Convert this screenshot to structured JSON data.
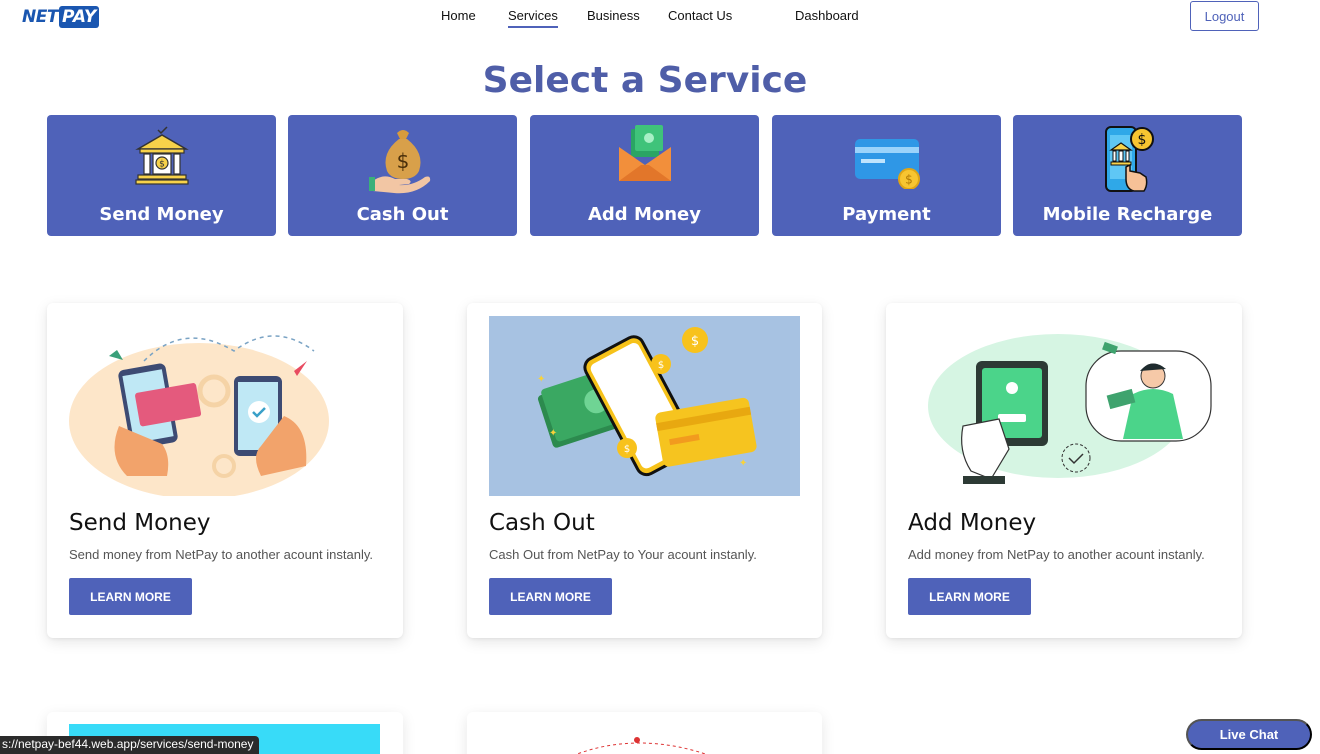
{
  "logo": {
    "part1": "NET",
    "part2": "PAY"
  },
  "nav": [
    {
      "label": "Home"
    },
    {
      "label": "Services"
    },
    {
      "label": "Business"
    },
    {
      "label": "Contact Us"
    },
    {
      "label": "Dashboard"
    }
  ],
  "logout_label": "Logout",
  "page_title": "Select a Service",
  "tiles": [
    {
      "label": "Send Money",
      "icon": "bank-icon"
    },
    {
      "label": "Cash Out",
      "icon": "money-bag-icon"
    },
    {
      "label": "Add Money",
      "icon": "envelope-money-icon"
    },
    {
      "label": "Payment",
      "icon": "credit-card-icon"
    },
    {
      "label": "Mobile Recharge",
      "icon": "phone-bank-icon"
    }
  ],
  "cards": [
    {
      "title": "Send Money",
      "text": "Send money from NetPay to another acount instanly.",
      "button": "LEARN MORE"
    },
    {
      "title": "Cash Out",
      "text": "Cash Out from NetPay to Your acount instanly.",
      "button": "LEARN MORE"
    },
    {
      "title": "Add Money",
      "text": "Add money from NetPay to another acount instanly.",
      "button": "LEARN MORE"
    }
  ],
  "status_url": "s://netpay-bef44.web.app/services/send-money",
  "live_chat": "Live Chat",
  "colors": {
    "primary": "#4f62b9",
    "title": "#4f5ea8",
    "logo": "#1a56b0",
    "cyan": "#38dbf8"
  }
}
